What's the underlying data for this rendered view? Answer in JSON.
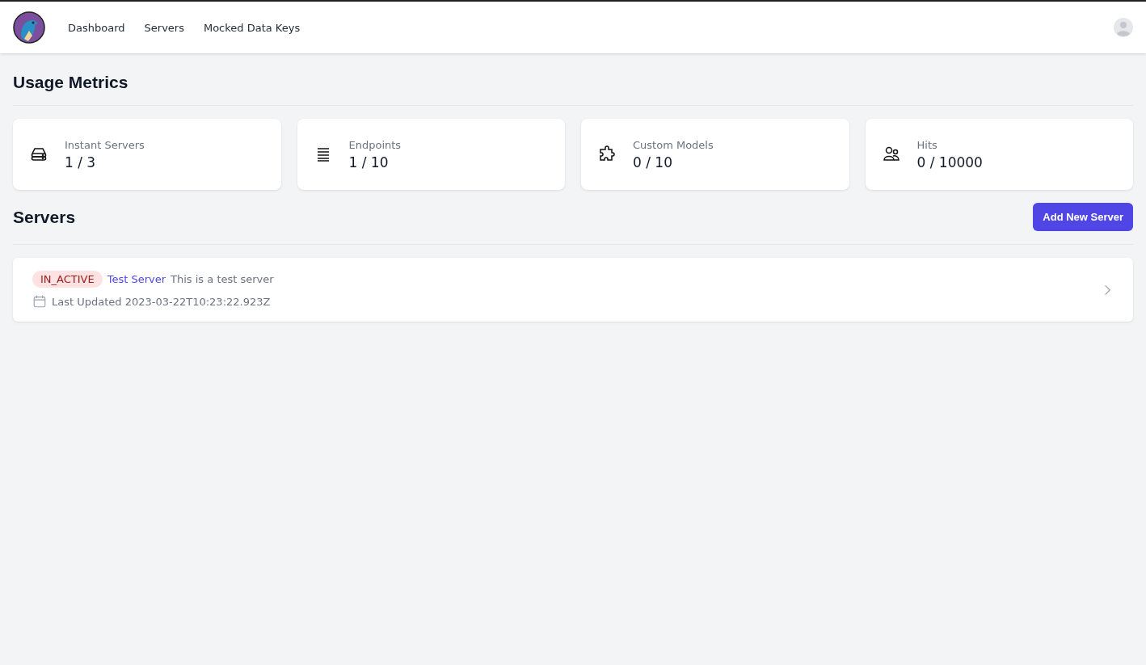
{
  "nav": {
    "items": [
      {
        "label": "Dashboard"
      },
      {
        "label": "Servers"
      },
      {
        "label": "Mocked Data Keys"
      }
    ]
  },
  "usage": {
    "title": "Usage Metrics",
    "metrics": [
      {
        "kind": "servers",
        "label": "Instant Servers",
        "value": "1 / 3"
      },
      {
        "kind": "endpoints",
        "label": "Endpoints",
        "value": "1 / 10"
      },
      {
        "kind": "models",
        "label": "Custom Models",
        "value": "0 / 10"
      },
      {
        "kind": "hits",
        "label": "Hits",
        "value": "0 / 10000"
      }
    ]
  },
  "servers": {
    "title": "Servers",
    "add_button": "Add New Server",
    "items": [
      {
        "status": "IN_ACTIVE",
        "active": false,
        "name": "Test Server",
        "description": "This is a test server",
        "updated": "Last Updated 2023-03-22T10:23:22.923Z"
      }
    ]
  }
}
